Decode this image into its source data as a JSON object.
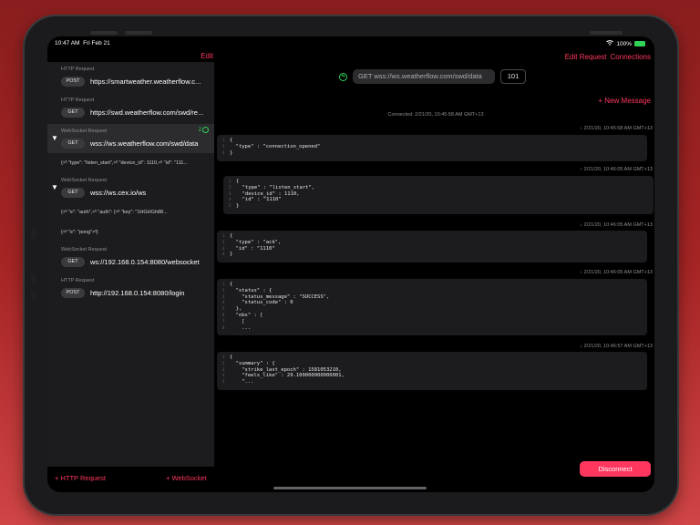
{
  "status": {
    "time": "10:47 AM",
    "date": "Fri Feb 21",
    "battery": "100%"
  },
  "sidebar": {
    "edit_label": "Edit",
    "add_http_label": "+ HTTP Request",
    "add_ws_label": "+ WebSocket",
    "items": [
      {
        "type": "HTTP Request",
        "method": "POST",
        "url": "https://smartweather.weatherflow.c..."
      },
      {
        "type": "HTTP Request",
        "method": "GET",
        "url": "https://swd.weatherflow.com/swd/re..."
      },
      {
        "type": "WebSocket Request",
        "method": "GET",
        "url": "wss://ws.weatherflow.com/swd/data",
        "count": "2",
        "messages": [
          "{⏎   \"type\": \"listen_start\",⏎   \"device_id\": 1110,⏎ \"id\": \"111..."
        ]
      },
      {
        "type": "WebSocket Request",
        "method": "GET",
        "url": "wss://ws.cex.io/ws",
        "messages": [
          "{⏎   \"e\": \"auth\",⏎   \"auth\": {⏎               \"key\": \"1HGHGh88...",
          "{⏎   \"e\": \"pong\"⏎}"
        ]
      },
      {
        "type": "WebSocket Request",
        "method": "GET",
        "url": "ws://192.168.0.154:8080/websocket"
      },
      {
        "type": "HTTP Request",
        "method": "POST",
        "url": "http://192.168.0.154:8080/login"
      }
    ]
  },
  "detail": {
    "edit_request_label": "Edit Request",
    "connections_label": "Connections",
    "url_text": "GET wss://ws.weatherflow.com/swd/data",
    "port_value": "101",
    "new_message_label": "+ New Message",
    "connected_text": "Connected:    2/21/20, 10:45:58 AM GMT+13",
    "disconnect_label": "Disconnect",
    "messages": [
      {
        "direction": "↓",
        "timestamp": "2/21/20, 10:45:58 AM GMT+13",
        "lines": [
          "{",
          "  \"type\" : \"connection_opened\"",
          "}"
        ]
      },
      {
        "direction": "↑",
        "timestamp": "2/21/20, 10:46:05 AM GMT+13",
        "lines": [
          "{",
          "  \"type\" : \"listen_start\",",
          "  \"device_id\" : 1110,",
          "  \"id\" : \"1110\"",
          "}"
        ]
      },
      {
        "direction": "↓",
        "timestamp": "2/21/20, 10:46:05 AM GMT+13",
        "lines": [
          "{",
          "  \"type\" : \"ack\",",
          "  \"id\" : \"1110\"",
          "}"
        ]
      },
      {
        "direction": "↓",
        "timestamp": "2/21/20, 10:46:05 AM GMT+13",
        "lines": [
          "{",
          "  \"status\" : {",
          "    \"status_message\" : \"SUCCESS\",",
          "    \"status_code\" : 0",
          "  },",
          "  \"obs\" : [",
          "    [",
          "    ..."
        ]
      },
      {
        "direction": "↓",
        "timestamp": "2/21/20, 10:46:57 AM GMT+13",
        "lines": [
          "{",
          "  \"summary\" : {",
          "    \"strike_last_epoch\" : 1581053210,",
          "    \"feels_like\" : 29.100000000000001,",
          "    \"..."
        ]
      }
    ]
  },
  "colors": {
    "accent": "#ff375f",
    "connected": "#30d158",
    "background": "#000000"
  }
}
